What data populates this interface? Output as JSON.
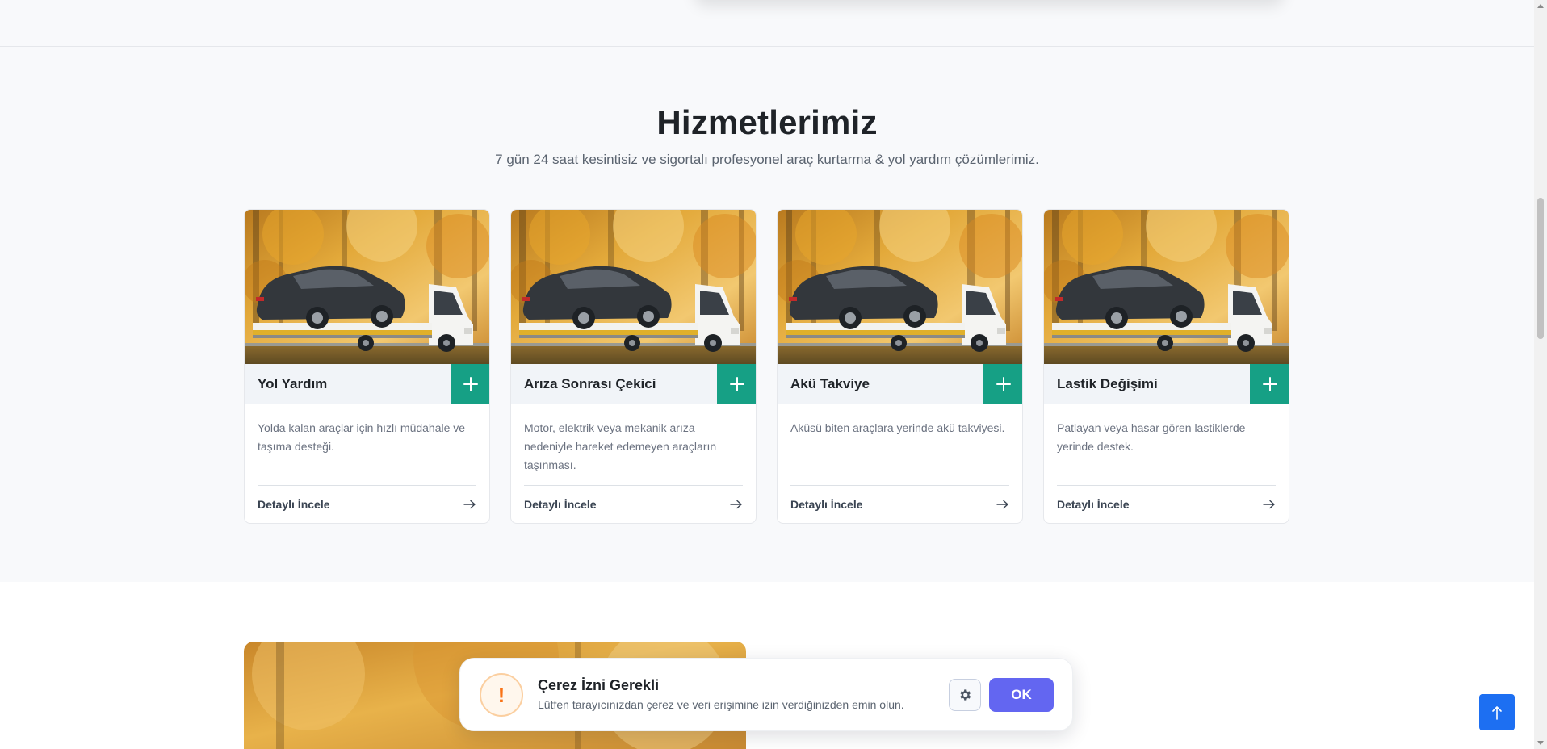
{
  "services": {
    "title": "Hizmetlerimiz",
    "subtitle": "7 gün 24 saat kesintisiz ve sigortalı profesyonel araç kurtarma & yol yardım çözümlerimiz.",
    "cards": [
      {
        "title": "Yol Yardım",
        "description": "Yolda kalan araçlar için hızlı müdahale ve taşıma desteği.",
        "link_label": "Detaylı İncele"
      },
      {
        "title": "Arıza Sonrası Çekici",
        "description": "Motor, elektrik veya mekanik arıza nedeniyle hareket edemeyen araçların taşınması.",
        "link_label": "Detaylı İncele"
      },
      {
        "title": "Akü Takviye",
        "description": "Aküsü biten araçlara yerinde akü takviyesi.",
        "link_label": "Detaylı İncele"
      },
      {
        "title": "Lastik Değişimi",
        "description": "Patlayan veya hasar gören lastiklerde yerinde destek.",
        "link_label": "Detaylı İncele"
      }
    ]
  },
  "cookie_banner": {
    "title": "Çerez İzni Gerekli",
    "text": "Lütfen tarayıcınızdan çerez ve veri erişimine izin verdiğinizden emin olun.",
    "icon_glyph": "!",
    "ok_label": "OK"
  },
  "colors": {
    "accent_green": "#16a085",
    "ok_button": "#6366f1",
    "back_to_top": "#1d6ff2",
    "warning": "#f97316"
  },
  "icons": {
    "card_image": "tow-truck-photo",
    "plus": "plus-icon",
    "arrow": "arrow-right-icon",
    "cookie": "exclamation-icon",
    "settings": "gear-icon",
    "back_to_top": "arrow-up-icon"
  }
}
